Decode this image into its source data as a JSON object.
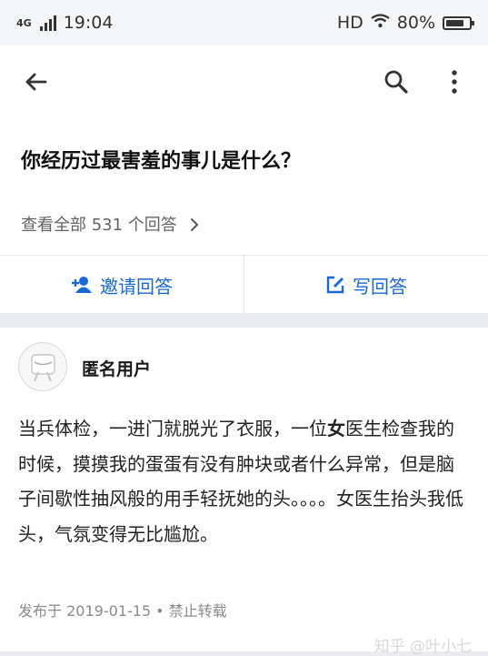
{
  "status_bar": {
    "network": "4G",
    "time": "19:04",
    "hd": "HD",
    "battery": "80%",
    "battery_level": 0.8
  },
  "question": {
    "title": "你经历过最害羞的事儿是什么？",
    "answer_count": "查看全部 531 个回答"
  },
  "actions": {
    "invite": "邀请回答",
    "write": "写回答"
  },
  "answer": {
    "author": "匿名用户",
    "content_before": "当兵体检，一进门就脱光了衣服，一位",
    "content_bold": "女",
    "content_after": "医生检查我的时候，摸摸我的蛋蛋有没有肿块或者什么异常，但是脑子间歇性抽风般的用手轻抚她的头。。。。女医生抬头我低头，气氛变得无比尴尬。",
    "meta": "发布于 2019-01-15 • 禁止转载"
  },
  "watermark": "知乎 @叶小七",
  "icons": [
    "back-arrow-icon",
    "search-icon",
    "more-vert-icon",
    "invite-icon",
    "write-icon",
    "avatar-icon",
    "chevron-right-icon",
    "wifi-icon",
    "battery-icon",
    "signal-icon"
  ]
}
